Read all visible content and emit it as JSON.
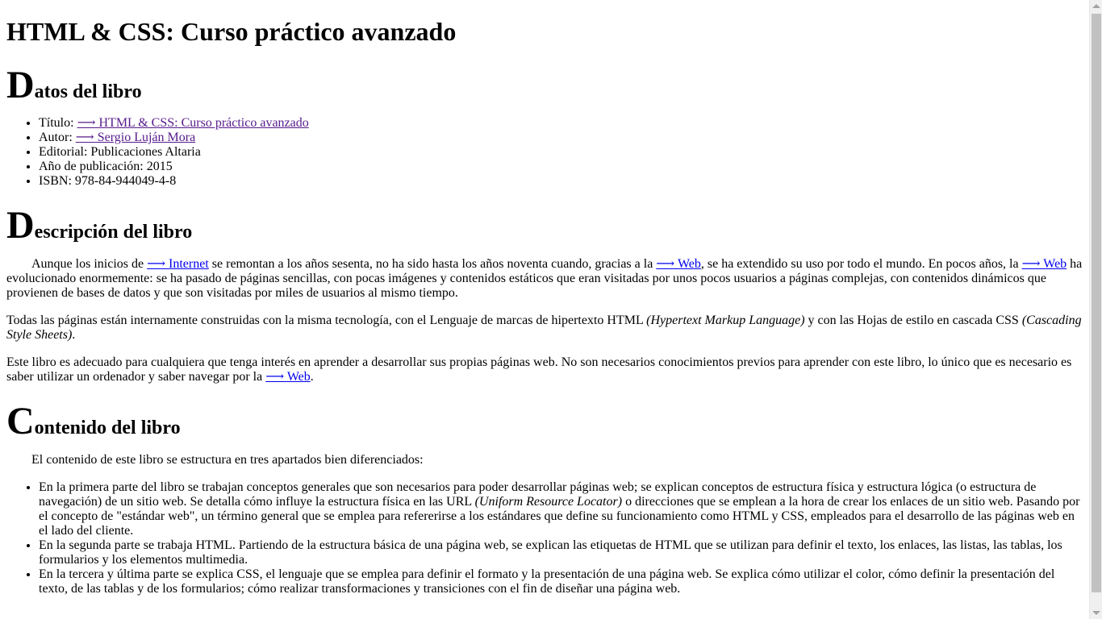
{
  "title": "HTML & CSS: Curso práctico avanzado",
  "datos": {
    "heading_initial": "D",
    "heading_rest": "atos del libro",
    "titulo_label": "Título: ",
    "titulo_link": "⟶ HTML & CSS: Curso práctico avanzado",
    "autor_label": "Autor: ",
    "autor_link": "⟶ Sergio Luján Mora",
    "editorial": "Editorial: Publicaciones Altaria",
    "anio": "Año de publicación: 2015",
    "isbn": "ISBN: 978-84-944049-4-8"
  },
  "descripcion": {
    "heading_initial": "D",
    "heading_rest": "escripción del libro",
    "p1_a": "Aunque los inicios de ",
    "p1_link1": "⟶ Internet",
    "p1_b": " se remontan a los años sesenta, no ha sido hasta los años noventa cuando, gracias a la ",
    "p1_link2": "⟶ Web",
    "p1_c": ", se ha extendido su uso por todo el mundo. En pocos años, la ",
    "p1_link3": "⟶ Web",
    "p1_d": " ha evolucionado enormemente: se ha pasado de páginas sencillas, con pocas imágenes y contenidos estáticos que eran visitadas por unos pocos usuarios a páginas complejas, con contenidos dinámicos que provienen de bases de datos y que son visitadas por miles de usuarios al mismo tiempo.",
    "p2_a": "Todas las páginas están internamente construidas con la misma tecnología, con el Lenguaje de marcas de hipertexto HTML ",
    "p2_i1": "(Hypertext Markup Language)",
    "p2_b": " y con las Hojas de estilo en cascada CSS ",
    "p2_i2": "(Cascading Style Sheets)",
    "p2_c": ".",
    "p3_a": "Este libro es adecuado para cualquiera que tenga interés en aprender a desarrollar sus propias páginas web. No son necesarios conocimientos previos para aprender con este libro, lo único que es necesario es saber utilizar un ordenador y saber navegar por la ",
    "p3_link": "⟶ Web",
    "p3_b": "."
  },
  "contenido": {
    "heading_initial": "C",
    "heading_rest": "ontenido del libro",
    "intro": "El contenido de este libro se estructura en tres apartados bien diferenciados:",
    "item1_a": "En la primera parte del libro se trabajan conceptos generales que son necesarios para poder desarrollar páginas web; se explican conceptos de estructura física y estructura lógica (o estructura de navegación) de un sitio web. Se detalla cómo influye la estructura física en las URL ",
    "item1_i": "(Uniform Resource Locator)",
    "item1_b": " o direcciones que se emplean a la hora de crear los enlaces de un sitio web. Pasando por el concepto de \"estándar web\", un término general que se emplea para refererirse a los estándares que define su funcionamiento como HTML y CSS, empleados para el desarrollo de las páginas web en el lado del cliente.",
    "item2": "En la segunda parte se trabaja HTML. Partiendo de la estructura básica de una página web, se explican las etiquetas de HTML que se utilizan para definir el texto, los enlaces, las listas, las tablas, los formularios y los elementos multimedia.",
    "item3": "En la tercera y última parte se explica CSS, el lenguaje que se emplea para definir el formato y la presentación de una página web. Se explica cómo utilizar el color, cómo definir la presentación del texto, de las tablas y de los formularios; cómo realizar transformaciones y transiciones con el fin de diseñar una página web."
  }
}
